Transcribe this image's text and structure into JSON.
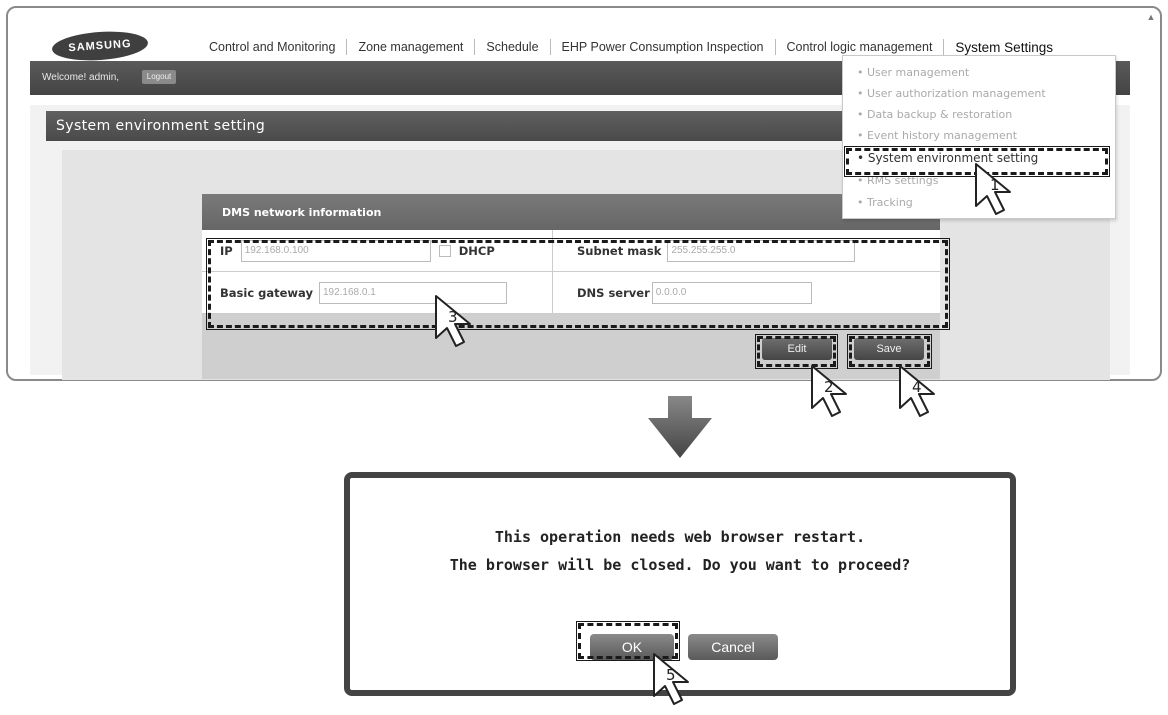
{
  "header": {
    "logo_text": "SAMSUNG",
    "nav_items": [
      "Control and Monitoring",
      "Zone management",
      "Schedule",
      "EHP Power Consumption Inspection",
      "Control logic management",
      "System Settings"
    ]
  },
  "welcome_bar": {
    "text": "Welcome! admin,",
    "logout_label": "Logout"
  },
  "page": {
    "title": "System environment setting"
  },
  "dropdown": {
    "items": [
      "• User management",
      "• User authorization management",
      "• Data backup & restoration",
      "• Event history management",
      "• System environment setting",
      "• RMS settings",
      "• Tracking"
    ]
  },
  "dms": {
    "title": "DMS network information",
    "ip_label": "IP",
    "ip_value": "192.168.0.100",
    "dhcp_label": "DHCP",
    "subnet_label": "Subnet mask",
    "subnet_value": "255.255.255.0",
    "gateway_label": "Basic gateway",
    "gateway_value": "192.168.0.1",
    "dns_label": "DNS server",
    "dns_value": "0.0.0.0",
    "edit_label": "Edit",
    "save_label": "Save"
  },
  "dialog": {
    "line1": "This operation needs web browser restart.",
    "line2": "The browser will be closed. Do you want to proceed?",
    "ok_label": "OK",
    "cancel_label": "Cancel"
  },
  "steps": [
    "1",
    "2",
    "3",
    "4",
    "5"
  ]
}
